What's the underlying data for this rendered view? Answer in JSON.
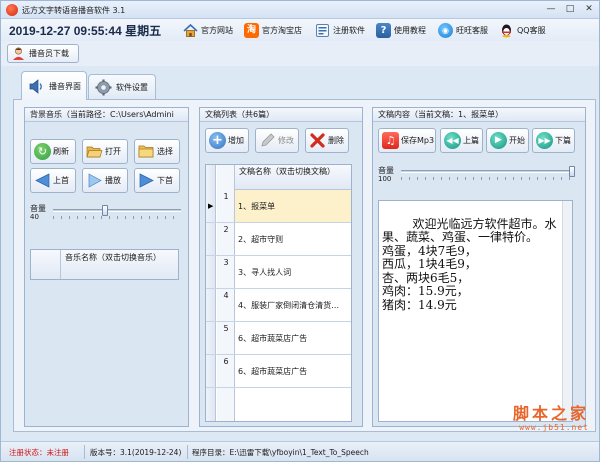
{
  "window": {
    "title": "远方文字转语音播音软件 3.1",
    "controls": [
      "—",
      "□",
      "✕"
    ]
  },
  "toolbar": {
    "datetime": "2019-12-27 09:55:44",
    "weekday": "星期五",
    "links": [
      {
        "label": "官方网站",
        "icon": "home-icon"
      },
      {
        "label": "官方淘宝店",
        "icon": "taobao-icon"
      },
      {
        "label": "注册软件",
        "icon": "register-icon"
      },
      {
        "label": "使用教程",
        "icon": "help-icon"
      },
      {
        "label": "旺旺客服",
        "icon": "wangwang-icon"
      },
      {
        "label": "QQ客服",
        "icon": "qq-icon"
      }
    ],
    "download_button": {
      "label": "播音员下载",
      "icon": "user-icon"
    }
  },
  "tabs": [
    {
      "label": "播音界面",
      "icon": "speaker-icon",
      "active": true
    },
    {
      "label": "软件设置",
      "icon": "gear-icon",
      "active": false
    }
  ],
  "music_panel": {
    "title": "背景音乐（当前路径：C:\\Users\\Admini",
    "buttons": [
      {
        "label": "刷新",
        "icon": "refresh-icon"
      },
      {
        "label": "打开",
        "icon": "open-folder-icon"
      },
      {
        "label": "选择",
        "icon": "select-folder-icon"
      },
      {
        "label": "上首",
        "icon": "previous-icon"
      },
      {
        "label": "播放",
        "icon": "play-icon"
      },
      {
        "label": "下首",
        "icon": "next-icon"
      }
    ],
    "volume_label": "音量",
    "volume_value": "40",
    "volume_level": 40,
    "column_header": "音乐名称（双击切换音乐）"
  },
  "list_panel": {
    "title": "文稿列表（共6篇）",
    "buttons": [
      {
        "label": "增加",
        "icon": "add-icon",
        "enabled": true
      },
      {
        "label": "修改",
        "icon": "edit-icon",
        "enabled": false
      },
      {
        "label": "删除",
        "icon": "delete-icon",
        "enabled": true
      }
    ],
    "column_header": "文稿名称（双击切换文稿）",
    "rows": [
      {
        "num": "1",
        "name": "1、报菜单",
        "selected": true
      },
      {
        "num": "2",
        "name": "2、超市守则",
        "selected": false
      },
      {
        "num": "3",
        "name": "3、寻人找人词",
        "selected": false
      },
      {
        "num": "4",
        "name": "4、服装厂家倒闭清仓清货…",
        "selected": false
      },
      {
        "num": "5",
        "name": "6、超市蔬菜店广告",
        "selected": false
      },
      {
        "num": "6",
        "name": "6、超市蔬菜店广告",
        "selected": false
      }
    ]
  },
  "content_panel": {
    "title": "文稿内容（当前文稿：1、报菜单）",
    "buttons": [
      {
        "label": "保存Mp3",
        "icon": "music-note-icon"
      },
      {
        "label": "上篇",
        "icon": "rewind-icon"
      },
      {
        "label": "开始",
        "icon": "start-icon"
      },
      {
        "label": "下篇",
        "icon": "fast-forward-icon"
      }
    ],
    "volume_label": "音量",
    "volume_value": "100",
    "volume_level": 100,
    "text": "欢迎光临远方软件超市。水果、蔬菜、鸡蛋、一律特价。\n鸡蛋，4块7毛9，\n西瓜，1块4毛9，\n杏、两块6毛5，\n鸡肉：15.9元，\n猪肉：14.9元"
  },
  "status_bar": {
    "register_status": "注册状态：未注册",
    "version": "版本号：3.1(2019-12-24)",
    "program_dir": "程序目录：E:\\迅雷下载\\yfboyin\\1_Text_To_Speech"
  },
  "watermark": {
    "text": "脚本之家",
    "url": "www.jb51.net"
  },
  "colors": {
    "accent_red": "#d01010",
    "selected_row": "#fdf1cc",
    "watermark": "#e8662b",
    "button_green": "#2f9e4a",
    "button_teal": "#1a9b8a"
  }
}
